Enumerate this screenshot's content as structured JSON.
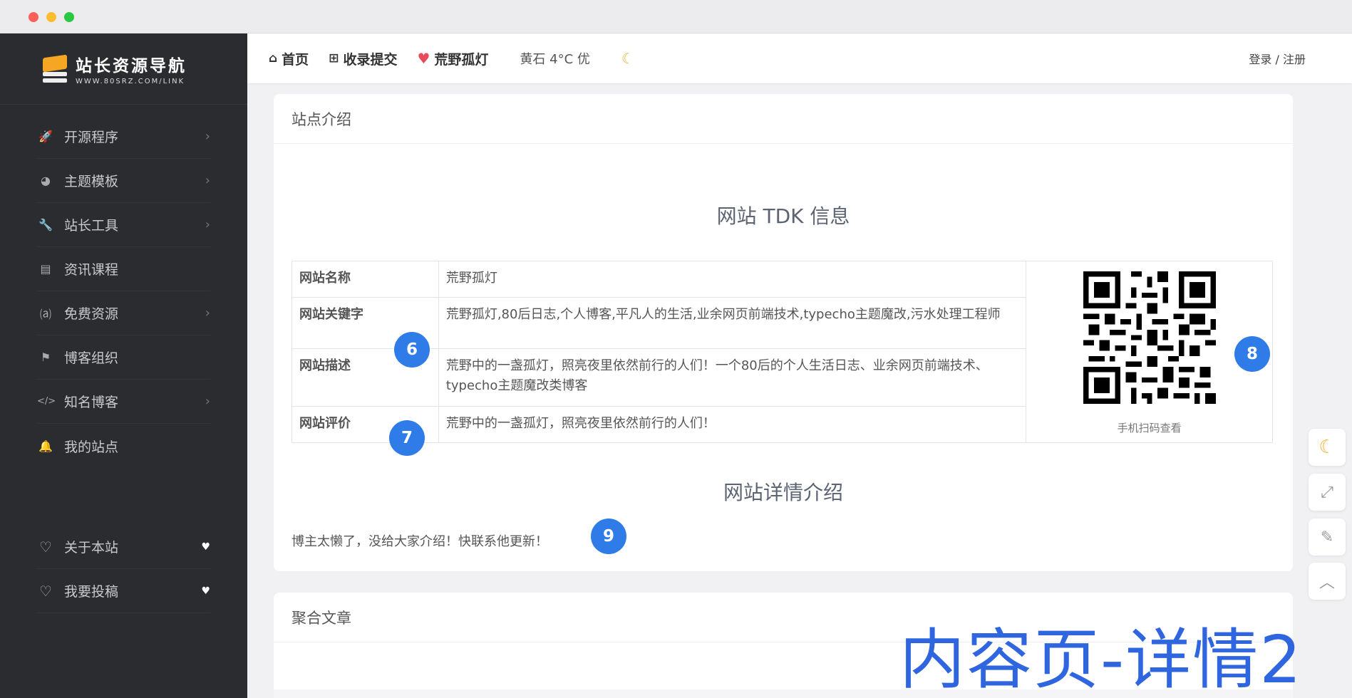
{
  "window": {
    "title": ""
  },
  "sidebar": {
    "logo": {
      "title": "站长资源导航",
      "subtitle": "WWW.80SRZ.COM/LINK"
    },
    "items": [
      {
        "label": "开源程序",
        "icon": "rocket-icon",
        "glyph": "🚀",
        "has_chevron": true
      },
      {
        "label": "主题模板",
        "icon": "palette-icon",
        "glyph": "◕",
        "has_chevron": true
      },
      {
        "label": "站长工具",
        "icon": "wrench-icon",
        "glyph": "🔧",
        "has_chevron": true
      },
      {
        "label": "资讯课程",
        "icon": "book-icon",
        "glyph": "▤",
        "has_chevron": false
      },
      {
        "label": "免费资源",
        "icon": "fire-icon",
        "glyph": "⒜",
        "has_chevron": true
      },
      {
        "label": "博客组织",
        "icon": "flag-icon",
        "glyph": "⚑",
        "has_chevron": false
      },
      {
        "label": "知名博客",
        "icon": "code-icon",
        "glyph": "</>",
        "has_chevron": true
      },
      {
        "label": "我的站点",
        "icon": "bell-icon",
        "glyph": "🔔",
        "has_chevron": false
      }
    ],
    "bottom_items": [
      {
        "label": "关于本站",
        "icon": "heart-outline-icon",
        "glyph": "♡"
      },
      {
        "label": "我要投稿",
        "icon": "heart-outline-icon",
        "glyph": "♡"
      }
    ]
  },
  "topbar": {
    "home": "首页",
    "submit": "收录提交",
    "site": "荒野孤灯",
    "weather": "黄石 4°C 优",
    "login": "登录 / 注册"
  },
  "intro_card": {
    "heading": "站点介绍",
    "tdk_title": "网站 TDK 信息",
    "rows": [
      {
        "key": "网站名称",
        "value": "荒野孤灯"
      },
      {
        "key": "网站关键字",
        "value": "荒野孤灯,80后日志,个人博客,平凡人的生活,业余网页前端技术,typecho主题魔改,污水处理工程师"
      },
      {
        "key": "网站描述",
        "value": "荒野中的一盏孤灯，照亮夜里依然前行的人们！一个80后的个人生活日志、业余网页前端技术、typecho主题魔改类博客"
      },
      {
        "key": "网站评价",
        "value": "荒野中的一盏孤灯，照亮夜里依然前行的人们！"
      }
    ],
    "qr_caption": "手机扫码查看",
    "detail_title": "网站详情介绍",
    "detail_text": "博主太懒了，没给大家介绍！快联系他更新！"
  },
  "articles_card": {
    "heading": "聚合文章"
  },
  "badges": [
    "6",
    "7",
    "8",
    "9"
  ],
  "watermark": "内容页-详情2",
  "colors": {
    "sidebar_bg": "#2b2c2f",
    "accent_blue": "#2f7be8",
    "moon": "#f4b13b",
    "heart": "#e84b5a"
  }
}
